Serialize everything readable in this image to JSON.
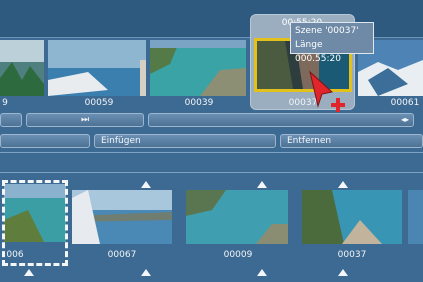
{
  "timeline_top": {
    "clips": [
      {
        "label": "9"
      },
      {
        "label": "00059"
      },
      {
        "label": "00039"
      },
      {
        "label": "00037"
      },
      {
        "label": "00061"
      }
    ],
    "selected_clip_time": "00:55:20"
  },
  "tooltip": {
    "line1": "Szene '00037'",
    "line2": "Länge 000.55:20"
  },
  "controls": {
    "insert_label": "Einfügen",
    "remove_label": "Entfernen",
    "skip_next_glyph": "⏭",
    "arrows_glyph": "◂▸"
  },
  "bin_clips": [
    {
      "label": "006"
    },
    {
      "label": "00067"
    },
    {
      "label": "00009"
    },
    {
      "label": "00037"
    }
  ],
  "colors": {
    "background": "#3d6a92",
    "selection": "#e2c21a",
    "cursor": "#e0262a"
  }
}
